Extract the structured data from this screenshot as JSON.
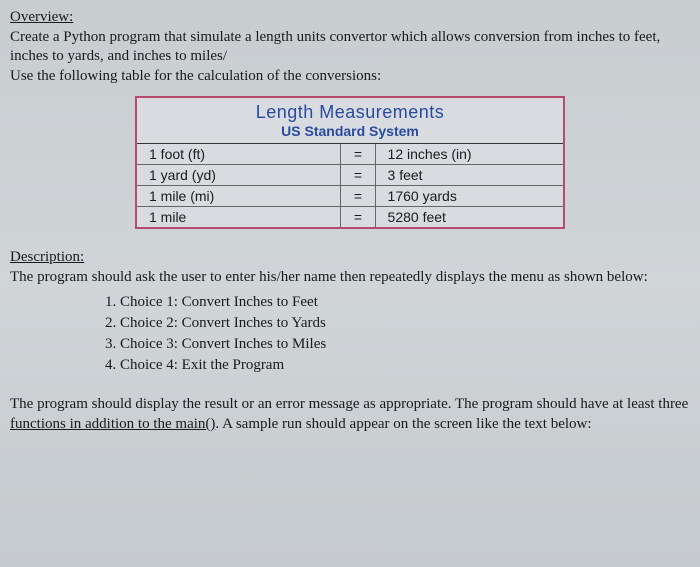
{
  "overview": {
    "title": "Overview:",
    "line1": "Create a Python program that simulate a length units convertor which allows conversion from inches to feet, inches to yards, and inches to miles/",
    "line2": "Use the following table for the calculation of the conversions:"
  },
  "table": {
    "title": "Length Measurements",
    "subtitle": "US Standard System",
    "rows": [
      {
        "left": "1 foot (ft)",
        "eq": "=",
        "right": "12 inches (in)"
      },
      {
        "left": "1 yard (yd)",
        "eq": "=",
        "right": "3 feet"
      },
      {
        "left": "1 mile (mi)",
        "eq": "=",
        "right": "1760 yards"
      },
      {
        "left": "1 mile",
        "eq": "=",
        "right": "5280 feet"
      }
    ]
  },
  "description": {
    "title": "Description:",
    "intro": "The program should ask the user to enter his/her name then repeatedly displays the menu as shown below:",
    "menu": [
      "Choice 1: Convert Inches to Feet",
      "Choice 2: Convert Inches to Yards",
      "Choice 3: Convert Inches to Miles",
      "Choice 4: Exit the Program"
    ]
  },
  "final": {
    "part1": "The program should display the result or an error message as appropriate. The program should have at least three ",
    "underlined": "functions in addition to the main()",
    "part2": ". A sample run should appear on the screen like the text below:"
  }
}
